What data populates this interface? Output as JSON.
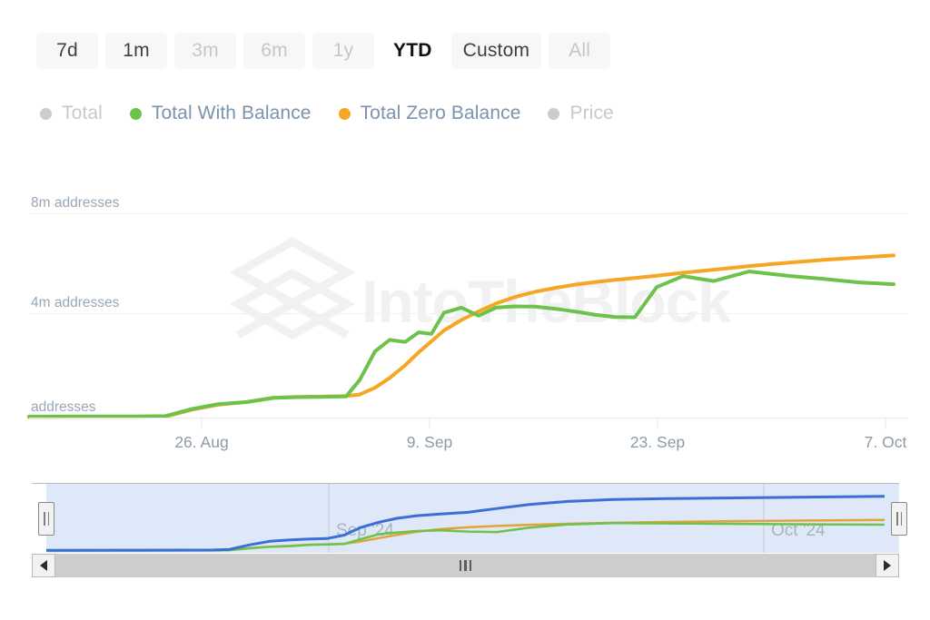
{
  "range_selector": {
    "buttons": [
      {
        "label": "7d",
        "state": "normal"
      },
      {
        "label": "1m",
        "state": "normal"
      },
      {
        "label": "3m",
        "state": "muted"
      },
      {
        "label": "6m",
        "state": "muted"
      },
      {
        "label": "1y",
        "state": "muted"
      },
      {
        "label": "YTD",
        "state": "selected"
      },
      {
        "label": "Custom",
        "state": "normal"
      },
      {
        "label": "All",
        "state": "muted"
      }
    ]
  },
  "legend": {
    "items": [
      {
        "label": "Total",
        "color": "#cccccc",
        "active": false
      },
      {
        "label": "Total With Balance",
        "color": "#6cc24a",
        "active": true
      },
      {
        "label": "Total Zero Balance",
        "color": "#f5a623",
        "active": true
      },
      {
        "label": "Price",
        "color": "#cccccc",
        "active": false
      }
    ]
  },
  "watermark": {
    "text": "IntoTheBlock"
  },
  "navigator": {
    "month_labels": [
      "Sep '24",
      "Oct '24"
    ],
    "series_colors": {
      "total": "#3a6fd8",
      "with_balance": "#6cc24a",
      "zero_balance": "#e2a33c"
    }
  },
  "chart_data": {
    "type": "line",
    "title": "",
    "xlabel": "",
    "ylabel": "addresses",
    "grid": true,
    "legend_position": "top",
    "ylim": [
      0,
      8800000
    ],
    "y_ticks": [
      0,
      4000000,
      8000000
    ],
    "y_tick_labels": [
      "addresses",
      "4m addresses",
      "8m addresses"
    ],
    "x_tick_labels": [
      "26. Aug",
      "9. Sep",
      "23. Sep",
      "7. Oct"
    ],
    "x_tick_positions": [
      0.185,
      0.44,
      0.695,
      0.945
    ],
    "series": [
      {
        "name": "Total With Balance",
        "color": "#6cc24a",
        "x": [
          0.0,
          0.06,
          0.12,
          0.155,
          0.185,
          0.215,
          0.248,
          0.278,
          0.305,
          0.33,
          0.348,
          0.36,
          0.375,
          0.392,
          0.408,
          0.425,
          0.44,
          0.455,
          0.47,
          0.49,
          0.51,
          0.53,
          0.552,
          0.575,
          0.6,
          0.622,
          0.645,
          0.668,
          0.69,
          0.715,
          0.745,
          0.78,
          0.82,
          0.865,
          0.905,
          0.945,
          0.985
        ],
        "values": [
          60000,
          62000,
          65000,
          80000,
          330000,
          520000,
          600000,
          760000,
          790000,
          800000,
          810000,
          815000,
          1450000,
          2560000,
          3000000,
          2920000,
          3300000,
          3240000,
          4060000,
          4250000,
          3940000,
          4250000,
          4300000,
          4290000,
          4200000,
          4100000,
          3980000,
          3900000,
          3890000,
          5050000,
          5470000,
          5280000,
          5650000,
          5480000,
          5360000,
          5230000,
          5160000
        ]
      },
      {
        "name": "Total Zero Balance",
        "color": "#f5a623",
        "x": [
          0.0,
          0.06,
          0.12,
          0.155,
          0.185,
          0.215,
          0.248,
          0.278,
          0.305,
          0.33,
          0.348,
          0.36,
          0.375,
          0.392,
          0.408,
          0.425,
          0.44,
          0.455,
          0.47,
          0.49,
          0.51,
          0.53,
          0.552,
          0.575,
          0.6,
          0.622,
          0.645,
          0.668,
          0.69,
          0.715,
          0.745,
          0.78,
          0.82,
          0.865,
          0.905,
          0.945,
          0.985
        ],
        "values": [
          45000,
          47000,
          50000,
          70000,
          300000,
          490000,
          600000,
          740000,
          770000,
          780000,
          790000,
          800000,
          860000,
          1120000,
          1500000,
          1980000,
          2480000,
          2900000,
          3320000,
          3720000,
          4050000,
          4350000,
          4600000,
          4800000,
          4960000,
          5080000,
          5180000,
          5260000,
          5330000,
          5420000,
          5530000,
          5650000,
          5790000,
          5920000,
          6030000,
          6120000,
          6200000
        ]
      }
    ]
  }
}
